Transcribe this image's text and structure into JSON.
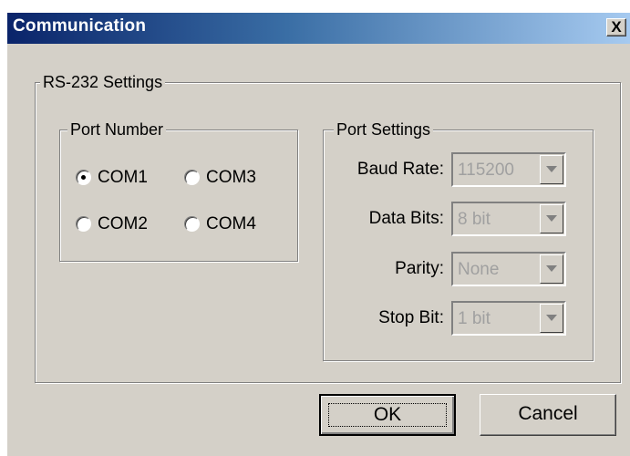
{
  "window": {
    "title": "Communication",
    "close_glyph": "X"
  },
  "rs232": {
    "legend": "RS-232 Settings",
    "port_number": {
      "legend": "Port Number",
      "options": [
        {
          "label": "COM1",
          "selected": true
        },
        {
          "label": "COM3",
          "selected": false
        },
        {
          "label": "COM2",
          "selected": false
        },
        {
          "label": "COM4",
          "selected": false
        }
      ]
    },
    "port_settings": {
      "legend": "Port Settings",
      "baud_rate": {
        "label": "Baud Rate:",
        "value": "115200",
        "enabled": false
      },
      "data_bits": {
        "label": "Data Bits:",
        "value": "8 bit",
        "enabled": false
      },
      "parity": {
        "label": "Parity:",
        "value": "None",
        "enabled": false
      },
      "stop_bit": {
        "label": "Stop Bit:",
        "value": "1 bit",
        "enabled": false
      }
    }
  },
  "buttons": {
    "ok": "OK",
    "cancel": "Cancel"
  },
  "icons": {
    "close": "close-icon",
    "dropdown": "chevron-down-icon",
    "radio": "radio-icon"
  },
  "colors": {
    "title_gradient_start": "#0a246a",
    "title_gradient_end": "#a6caf0",
    "dialog_face": "#d4d0c8",
    "disabled_text": "#a0a0a0"
  }
}
